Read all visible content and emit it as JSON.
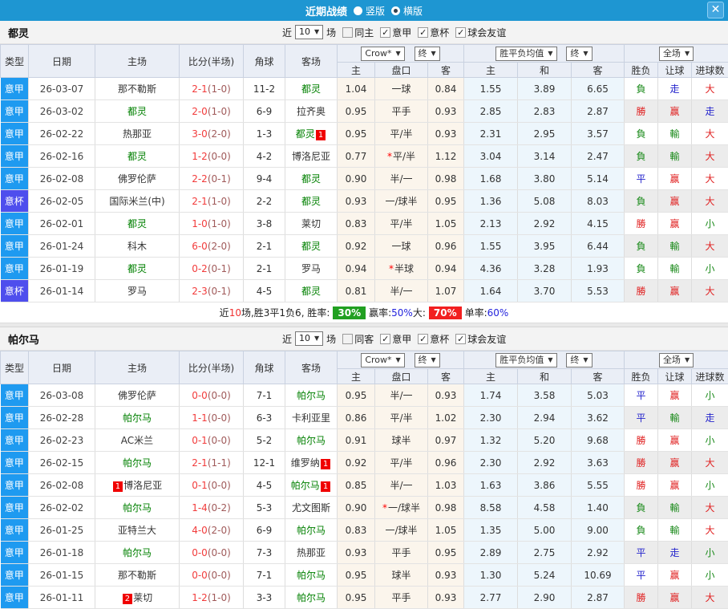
{
  "titlebar": {
    "title": "近期战绩",
    "vertical_label": "竖版",
    "vertical_selected": false,
    "horizontal_label": "横版",
    "horizontal_selected": true,
    "close": "✕"
  },
  "columns": {
    "type": "类型",
    "date": "日期",
    "home": "主场",
    "score": "比分(半场)",
    "corner": "角球",
    "away": "客场",
    "odds_home": "主",
    "handicap": "盘口",
    "odds_away": "客",
    "mean_home": "主",
    "mean_draw": "和",
    "mean_away": "客",
    "wdl": "胜负",
    "let": "让球",
    "goals": "进球数",
    "bookmaker": "Crow*",
    "final": "终",
    "mean_label": "胜平负均值",
    "fullmatch": "全场"
  },
  "colors": {
    "titlebar_blue": "#1e96d2",
    "league_blue": "#1e9af0",
    "cup_purple": "#4e4eed",
    "focal_green": "#008000",
    "win_red": "#e02020",
    "draw_blue": "#2424cc",
    "lose_green": "#1a8a1a",
    "rate_green_bg": "#21a021",
    "rate_red_bg": "#f21f1f"
  },
  "sections": [
    {
      "team": "都灵",
      "filter": {
        "near": "近",
        "count": "10",
        "games": "场",
        "same_label": "同主",
        "same_checked": false,
        "leagues": [
          {
            "label": "意甲",
            "checked": true
          },
          {
            "label": "意杯",
            "checked": true
          },
          {
            "label": "球会友谊",
            "checked": true
          }
        ]
      },
      "rows": [
        {
          "lg": "意甲",
          "date": "26-03-07",
          "home": "那不勒斯",
          "hFocal": false,
          "hBadge": "",
          "score": "2-1",
          "half": "(1-0)",
          "corner": "11-2",
          "away": "都灵",
          "aFocal": true,
          "aBadge": "",
          "oH": "1.04",
          "pan": "一球",
          "star": false,
          "oA": "0.84",
          "mH": "1.55",
          "mD": "3.89",
          "mA": "6.65",
          "res": "負",
          "let": "走",
          "goal": "大"
        },
        {
          "lg": "意甲",
          "date": "26-03-02",
          "home": "都灵",
          "hFocal": true,
          "hBadge": "",
          "score": "2-0",
          "half": "(1-0)",
          "corner": "6-9",
          "away": "拉齐奥",
          "aFocal": false,
          "aBadge": "",
          "oH": "0.95",
          "pan": "平手",
          "star": false,
          "oA": "0.93",
          "mH": "2.85",
          "mD": "2.83",
          "mA": "2.87",
          "res": "勝",
          "let": "赢",
          "goal": "走"
        },
        {
          "lg": "意甲",
          "date": "26-02-22",
          "home": "热那亚",
          "hFocal": false,
          "hBadge": "",
          "score": "3-0",
          "half": "(2-0)",
          "corner": "1-3",
          "away": "都灵",
          "aFocal": true,
          "aBadge": "1",
          "oH": "0.95",
          "pan": "平/半",
          "star": false,
          "oA": "0.93",
          "mH": "2.31",
          "mD": "2.95",
          "mA": "3.57",
          "res": "負",
          "let": "輸",
          "goal": "大"
        },
        {
          "lg": "意甲",
          "date": "26-02-16",
          "home": "都灵",
          "hFocal": true,
          "hBadge": "",
          "score": "1-2",
          "half": "(0-0)",
          "corner": "4-2",
          "away": "博洛尼亚",
          "aFocal": false,
          "aBadge": "",
          "oH": "0.77",
          "pan": "平/半",
          "star": true,
          "oA": "1.12",
          "mH": "3.04",
          "mD": "3.14",
          "mA": "2.47",
          "res": "負",
          "let": "輸",
          "goal": "大"
        },
        {
          "lg": "意甲",
          "date": "26-02-08",
          "home": "佛罗伦萨",
          "hFocal": false,
          "hBadge": "",
          "score": "2-2",
          "half": "(0-1)",
          "corner": "9-4",
          "away": "都灵",
          "aFocal": true,
          "aBadge": "",
          "oH": "0.90",
          "pan": "半/一",
          "star": false,
          "oA": "0.98",
          "mH": "1.68",
          "mD": "3.80",
          "mA": "5.14",
          "res": "平",
          "let": "赢",
          "goal": "大"
        },
        {
          "lg": "意杯",
          "date": "26-02-05",
          "home": "国际米兰(中)",
          "hFocal": false,
          "hBadge": "",
          "score": "2-1",
          "half": "(1-0)",
          "corner": "2-2",
          "away": "都灵",
          "aFocal": true,
          "aBadge": "",
          "oH": "0.93",
          "pan": "一/球半",
          "star": false,
          "oA": "0.95",
          "mH": "1.36",
          "mD": "5.08",
          "mA": "8.03",
          "res": "負",
          "let": "赢",
          "goal": "大"
        },
        {
          "lg": "意甲",
          "date": "26-02-01",
          "home": "都灵",
          "hFocal": true,
          "hBadge": "",
          "score": "1-0",
          "half": "(1-0)",
          "corner": "3-8",
          "away": "莱切",
          "aFocal": false,
          "aBadge": "",
          "oH": "0.83",
          "pan": "平/半",
          "star": false,
          "oA": "1.05",
          "mH": "2.13",
          "mD": "2.92",
          "mA": "4.15",
          "res": "勝",
          "let": "赢",
          "goal": "小"
        },
        {
          "lg": "意甲",
          "date": "26-01-24",
          "home": "科木",
          "hFocal": false,
          "hBadge": "",
          "score": "6-0",
          "half": "(2-0)",
          "corner": "2-1",
          "away": "都灵",
          "aFocal": true,
          "aBadge": "",
          "oH": "0.92",
          "pan": "一球",
          "star": false,
          "oA": "0.96",
          "mH": "1.55",
          "mD": "3.95",
          "mA": "6.44",
          "res": "負",
          "let": "輸",
          "goal": "大"
        },
        {
          "lg": "意甲",
          "date": "26-01-19",
          "home": "都灵",
          "hFocal": true,
          "hBadge": "",
          "score": "0-2",
          "half": "(0-1)",
          "corner": "2-1",
          "away": "罗马",
          "aFocal": false,
          "aBadge": "",
          "oH": "0.94",
          "pan": "半球",
          "star": true,
          "oA": "0.94",
          "mH": "4.36",
          "mD": "3.28",
          "mA": "1.93",
          "res": "負",
          "let": "輸",
          "goal": "小"
        },
        {
          "lg": "意杯",
          "date": "26-01-14",
          "home": "罗马",
          "hFocal": false,
          "hBadge": "",
          "score": "2-3",
          "half": "(0-1)",
          "corner": "4-5",
          "away": "都灵",
          "aFocal": true,
          "aBadge": "",
          "oH": "0.81",
          "pan": "半/一",
          "star": false,
          "oA": "1.07",
          "mH": "1.64",
          "mD": "3.70",
          "mA": "5.53",
          "res": "勝",
          "let": "赢",
          "goal": "大"
        }
      ],
      "summary": {
        "t1": "近",
        "games": "10",
        "t2": "场,胜3平1负6, 胜率:",
        "win_rate": "30%",
        "t3": "赢率:",
        "profit_rate": "50%",
        "t4": "大:",
        "big_rate": "70%",
        "t5": "单率:",
        "single_rate": "60%"
      }
    },
    {
      "team": "帕尔马",
      "filter": {
        "near": "近",
        "count": "10",
        "games": "场",
        "same_label": "同客",
        "same_checked": false,
        "leagues": [
          {
            "label": "意甲",
            "checked": true
          },
          {
            "label": "意杯",
            "checked": true
          },
          {
            "label": "球会友谊",
            "checked": true
          }
        ]
      },
      "rows": [
        {
          "lg": "意甲",
          "date": "26-03-08",
          "home": "佛罗伦萨",
          "hFocal": false,
          "hBadge": "",
          "score": "0-0",
          "half": "(0-0)",
          "corner": "7-1",
          "away": "帕尔马",
          "aFocal": true,
          "aBadge": "",
          "oH": "0.95",
          "pan": "半/一",
          "star": false,
          "oA": "0.93",
          "mH": "1.74",
          "mD": "3.58",
          "mA": "5.03",
          "res": "平",
          "let": "赢",
          "goal": "小"
        },
        {
          "lg": "意甲",
          "date": "26-02-28",
          "home": "帕尔马",
          "hFocal": true,
          "hBadge": "",
          "score": "1-1",
          "half": "(0-0)",
          "corner": "6-3",
          "away": "卡利亚里",
          "aFocal": false,
          "aBadge": "",
          "oH": "0.86",
          "pan": "平/半",
          "star": false,
          "oA": "1.02",
          "mH": "2.30",
          "mD": "2.94",
          "mA": "3.62",
          "res": "平",
          "let": "輸",
          "goal": "走"
        },
        {
          "lg": "意甲",
          "date": "26-02-23",
          "home": "AC米兰",
          "hFocal": false,
          "hBadge": "",
          "score": "0-1",
          "half": "(0-0)",
          "corner": "5-2",
          "away": "帕尔马",
          "aFocal": true,
          "aBadge": "",
          "oH": "0.91",
          "pan": "球半",
          "star": false,
          "oA": "0.97",
          "mH": "1.32",
          "mD": "5.20",
          "mA": "9.68",
          "res": "勝",
          "let": "赢",
          "goal": "小"
        },
        {
          "lg": "意甲",
          "date": "26-02-15",
          "home": "帕尔马",
          "hFocal": true,
          "hBadge": "",
          "score": "2-1",
          "half": "(1-1)",
          "corner": "12-1",
          "away": "维罗纳",
          "aFocal": false,
          "aBadge": "1",
          "oH": "0.92",
          "pan": "平/半",
          "star": false,
          "oA": "0.96",
          "mH": "2.30",
          "mD": "2.92",
          "mA": "3.63",
          "res": "勝",
          "let": "赢",
          "goal": "大"
        },
        {
          "lg": "意甲",
          "date": "26-02-08",
          "home": "博洛尼亚",
          "hFocal": false,
          "hBadge": "1",
          "score": "0-1",
          "half": "(0-0)",
          "corner": "4-5",
          "away": "帕尔马",
          "aFocal": true,
          "aBadge": "1",
          "oH": "0.85",
          "pan": "半/一",
          "star": false,
          "oA": "1.03",
          "mH": "1.63",
          "mD": "3.86",
          "mA": "5.55",
          "res": "勝",
          "let": "赢",
          "goal": "小"
        },
        {
          "lg": "意甲",
          "date": "26-02-02",
          "home": "帕尔马",
          "hFocal": true,
          "hBadge": "",
          "score": "1-4",
          "half": "(0-2)",
          "corner": "5-3",
          "away": "尤文图斯",
          "aFocal": false,
          "aBadge": "",
          "oH": "0.90",
          "pan": "一/球半",
          "star": true,
          "oA": "0.98",
          "mH": "8.58",
          "mD": "4.58",
          "mA": "1.40",
          "res": "負",
          "let": "輸",
          "goal": "大"
        },
        {
          "lg": "意甲",
          "date": "26-01-25",
          "home": "亚特兰大",
          "hFocal": false,
          "hBadge": "",
          "score": "4-0",
          "half": "(2-0)",
          "corner": "6-9",
          "away": "帕尔马",
          "aFocal": true,
          "aBadge": "",
          "oH": "0.83",
          "pan": "一/球半",
          "star": false,
          "oA": "1.05",
          "mH": "1.35",
          "mD": "5.00",
          "mA": "9.00",
          "res": "負",
          "let": "輸",
          "goal": "大"
        },
        {
          "lg": "意甲",
          "date": "26-01-18",
          "home": "帕尔马",
          "hFocal": true,
          "hBadge": "",
          "score": "0-0",
          "half": "(0-0)",
          "corner": "7-3",
          "away": "热那亚",
          "aFocal": false,
          "aBadge": "",
          "oH": "0.93",
          "pan": "平手",
          "star": false,
          "oA": "0.95",
          "mH": "2.89",
          "mD": "2.75",
          "mA": "2.92",
          "res": "平",
          "let": "走",
          "goal": "小"
        },
        {
          "lg": "意甲",
          "date": "26-01-15",
          "home": "那不勒斯",
          "hFocal": false,
          "hBadge": "",
          "score": "0-0",
          "half": "(0-0)",
          "corner": "7-1",
          "away": "帕尔马",
          "aFocal": true,
          "aBadge": "",
          "oH": "0.95",
          "pan": "球半",
          "star": false,
          "oA": "0.93",
          "mH": "1.30",
          "mD": "5.24",
          "mA": "10.69",
          "res": "平",
          "let": "赢",
          "goal": "小"
        },
        {
          "lg": "意甲",
          "date": "26-01-11",
          "home": "莱切",
          "hFocal": false,
          "hBadge": "2",
          "score": "1-2",
          "half": "(1-0)",
          "corner": "3-3",
          "away": "帕尔马",
          "aFocal": true,
          "aBadge": "",
          "oH": "0.95",
          "pan": "平手",
          "star": false,
          "oA": "0.93",
          "mH": "2.77",
          "mD": "2.90",
          "mA": "2.87",
          "res": "勝",
          "let": "赢",
          "goal": "大"
        }
      ]
    }
  ]
}
